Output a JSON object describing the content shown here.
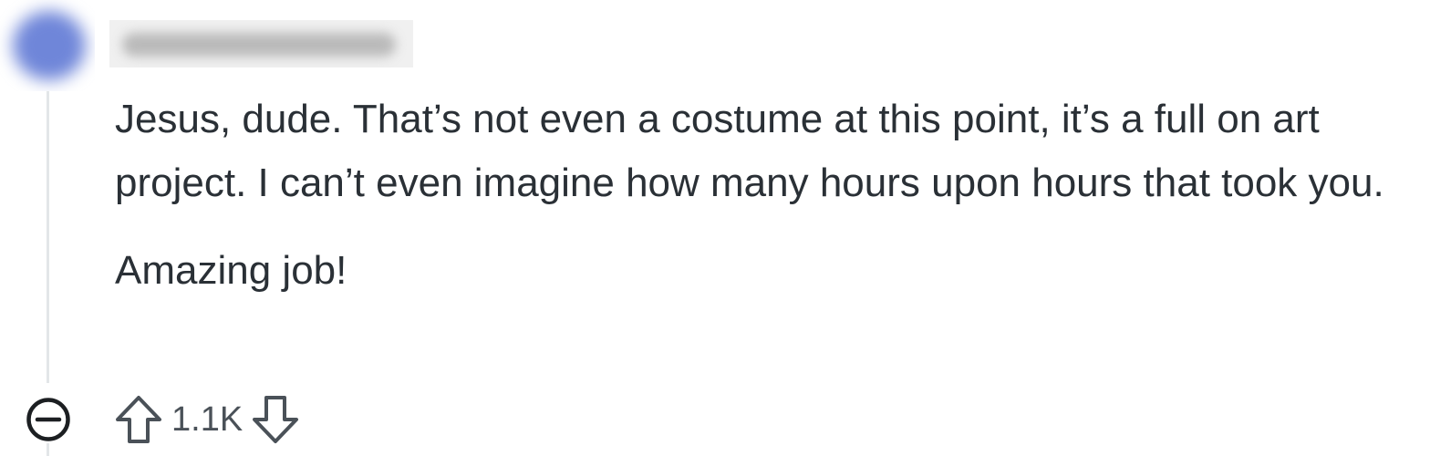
{
  "comment": {
    "paragraphs": [
      "Jesus, dude. That’s not even a costume at this point, it’s a full on art project. I can’t even imagine how many hours upon hours that took you.",
      "Amazing job!"
    ],
    "votes": "1.1K"
  },
  "icons": {
    "collapse": "minus-circle-icon",
    "upvote": "arrow-up-icon",
    "downvote": "arrow-down-icon"
  },
  "colors": {
    "text": "#2a3036",
    "icon": "#4a5158",
    "thread_line": "#e3e6e8",
    "avatar": "#6f86d9"
  }
}
